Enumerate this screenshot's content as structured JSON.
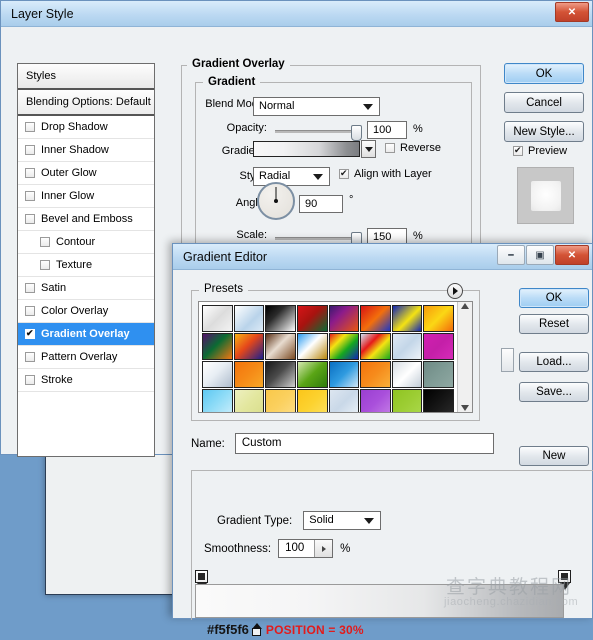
{
  "desktop": {
    "bg_color": "#6f9cc9"
  },
  "layer_style": {
    "title": "Layer Style",
    "window_buttons": {
      "close": "✕"
    },
    "styles_panel": {
      "header": "Styles",
      "blending_options": "Blending Options: Default",
      "items": [
        {
          "label": "Drop Shadow",
          "checked": false,
          "indent": false
        },
        {
          "label": "Inner Shadow",
          "checked": false,
          "indent": false
        },
        {
          "label": "Outer Glow",
          "checked": false,
          "indent": false
        },
        {
          "label": "Inner Glow",
          "checked": false,
          "indent": false
        },
        {
          "label": "Bevel and Emboss",
          "checked": false,
          "indent": false
        },
        {
          "label": "Contour",
          "checked": false,
          "indent": true
        },
        {
          "label": "Texture",
          "checked": false,
          "indent": true
        },
        {
          "label": "Satin",
          "checked": false,
          "indent": false
        },
        {
          "label": "Color Overlay",
          "checked": false,
          "indent": false
        },
        {
          "label": "Gradient Overlay",
          "checked": true,
          "indent": false,
          "selected": true
        },
        {
          "label": "Pattern Overlay",
          "checked": false,
          "indent": false
        },
        {
          "label": "Stroke",
          "checked": false,
          "indent": false
        }
      ],
      "selection_color": "#2f90f0"
    },
    "gradient_overlay": {
      "group_title": "Gradient Overlay",
      "sub_group_title": "Gradient",
      "blend_mode_label": "Blend Mode:",
      "blend_mode_value": "Normal",
      "opacity_label": "Opacity:",
      "opacity_value": "100",
      "opacity_unit": "%",
      "gradient_label": "Gradient:",
      "reverse_label": "Reverse",
      "reverse_checked": false,
      "style_label": "Style:",
      "style_value": "Radial",
      "align_label": "Align with Layer",
      "align_checked": true,
      "angle_label": "Angle:",
      "angle_value": "90",
      "angle_unit": "°",
      "scale_label": "Scale:",
      "scale_value": "150",
      "scale_unit": "%"
    },
    "buttons": {
      "ok": "OK",
      "cancel": "Cancel",
      "new_style": "New Style...",
      "preview_label": "Preview",
      "preview_checked": true
    }
  },
  "gradient_editor": {
    "title": "Gradient Editor",
    "window_buttons": {
      "minimize": "—",
      "maximize": "▣",
      "close": "✕"
    },
    "presets": {
      "label": "Presets",
      "swatches": [
        "linear-gradient(135deg,#ffffff 0%,#dcdcdc 50%,#f3f3f3 100%)",
        "linear-gradient(135deg,#ffffff 0%,#b9d3ea 60%,#dceaf6 100%)",
        "linear-gradient(135deg,#000000 0%,#2b2b2b 35%,#ffffff 100%)",
        "linear-gradient(135deg,#d61518 0%,#a8130f 45%,#0b6b33 100%)",
        "linear-gradient(135deg,#3b1a6e 0%,#8b1b8b 35%,#e8560f 100%)",
        "linear-gradient(135deg,#d81414 0%,#f36f0c 50%,#1b37c6 100%)",
        "linear-gradient(135deg,#1226b4 0%,#f4e312 55%,#1226b4 100%)",
        "linear-gradient(135deg,#f79a0c 0%,#fbd715 50%,#f36b0b 100%)",
        "linear-gradient(135deg,#54106b 0%,#0b6b33 45%,#f47611 100%)",
        "linear-gradient(135deg,#f7b214 0%,#e5471a 45%,#1a1f8e 100%)",
        "linear-gradient(135deg,#5a3117 0%,#e8dcd0 45%,#7b4a22 100%)",
        "linear-gradient(135deg,#2a9bf0 0%,#ffffff 45%,#b8860b 100%)",
        "linear-gradient(135deg,#e51b1b 0%,#f4e312 30%,#17a81f 60%,#1226b4 100%)",
        "linear-gradient(135deg,#cfe3f4 0%,#e51b1b 35%,#f4e312 60%,#17a81f 100%)",
        "linear-gradient(135deg,#dfe9f3 0%,#c3d6e8 50%,#eef3f8 100%)",
        "linear-gradient(135deg,#d11fb0 0%,#c41fa8 50%,#d62bb8 100%)",
        "linear-gradient(135deg,#ffffff 0%,#e8eef4 45%,#aebccc 100%)",
        "linear-gradient(135deg,#f4740c 0%,#f58a17 50%,#f8a827 100%)",
        "linear-gradient(135deg,#1b1b1b 0%,#4a4a4a 45%,#cfcfcf 100%)",
        "linear-gradient(135deg,#d5e8b0 0%,#5aa516 50%,#2f7a0c 100%)",
        "linear-gradient(135deg,#0a6fc2 0%,#2f9be0 50%,#cfe6f7 100%)",
        "linear-gradient(135deg,#f4730c 0%,#f68c1c 50%,#f9b03a 100%)",
        "linear-gradient(135deg,#d7dde3 0%,#ffffff 50%,#c2ccd6 100%)",
        "linear-gradient(135deg,#6f8a85 0%,#7f9b95 50%,#8fa8a2 100%)",
        "linear-gradient(135deg,#5ec8f2 0%,#8fdcf7 50%,#c9edfb 100%)",
        "linear-gradient(135deg,#eef0c0 0%,#e3e79f 50%,#d9de8c 100%)",
        "linear-gradient(135deg,#f9c84a 0%,#fbd05e 50%,#fcdd84 100%)",
        "linear-gradient(135deg,#fbc51a 0%,#fcd22f 50%,#fde05c 100%)",
        "linear-gradient(135deg,#dde6f0 0%,#c9d8e8 50%,#eaf1f7 100%)",
        "linear-gradient(135deg,#9a3fd1 0%,#a94fdb 50%,#c37ce6 100%)",
        "linear-gradient(135deg,#8fc422 0%,#9ccd33 50%,#aad84a 100%)",
        "linear-gradient(135deg,#000000 0%,#141414 50%,#2a2a2a 100%)"
      ]
    },
    "name_label": "Name:",
    "name_value": "Custom",
    "gradient_type_label": "Gradient Type:",
    "gradient_type_value": "Solid",
    "smoothness_label": "Smoothness:",
    "smoothness_value": "100",
    "smoothness_unit": "%",
    "annotation": {
      "hex": "#f5f5f6",
      "position_text": "POSITION = 30%",
      "position_color": "#e21b1b"
    },
    "buttons": {
      "ok": "OK",
      "reset": "Reset",
      "load": "Load...",
      "save": "Save...",
      "new": "New"
    }
  },
  "watermark": {
    "cn": "查字典教程网",
    "en": "jiaocheng.chazidian.com"
  }
}
